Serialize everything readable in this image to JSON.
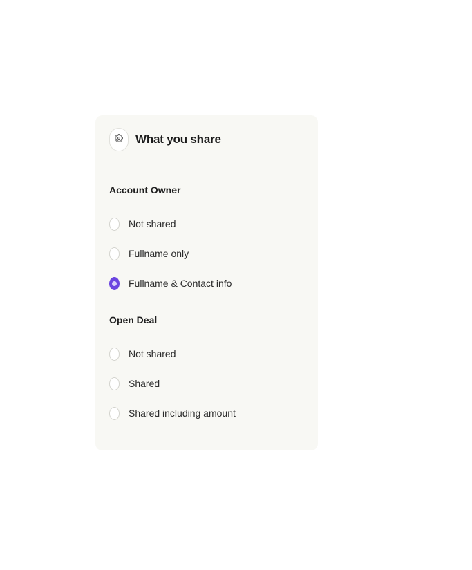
{
  "panel": {
    "title": "What you share",
    "icon": "gear-icon"
  },
  "sections": [
    {
      "title": "Account Owner",
      "options": [
        {
          "label": "Not shared",
          "selected": false
        },
        {
          "label": "Fullname only",
          "selected": false
        },
        {
          "label": "Fullname & Contact info",
          "selected": true
        }
      ]
    },
    {
      "title": "Open Deal",
      "options": [
        {
          "label": "Not shared",
          "selected": false
        },
        {
          "label": "Shared",
          "selected": false
        },
        {
          "label": "Shared including amount",
          "selected": false
        }
      ]
    }
  ],
  "colors": {
    "accent": "#6b45e0",
    "panel_background": "#f8f8f4"
  }
}
